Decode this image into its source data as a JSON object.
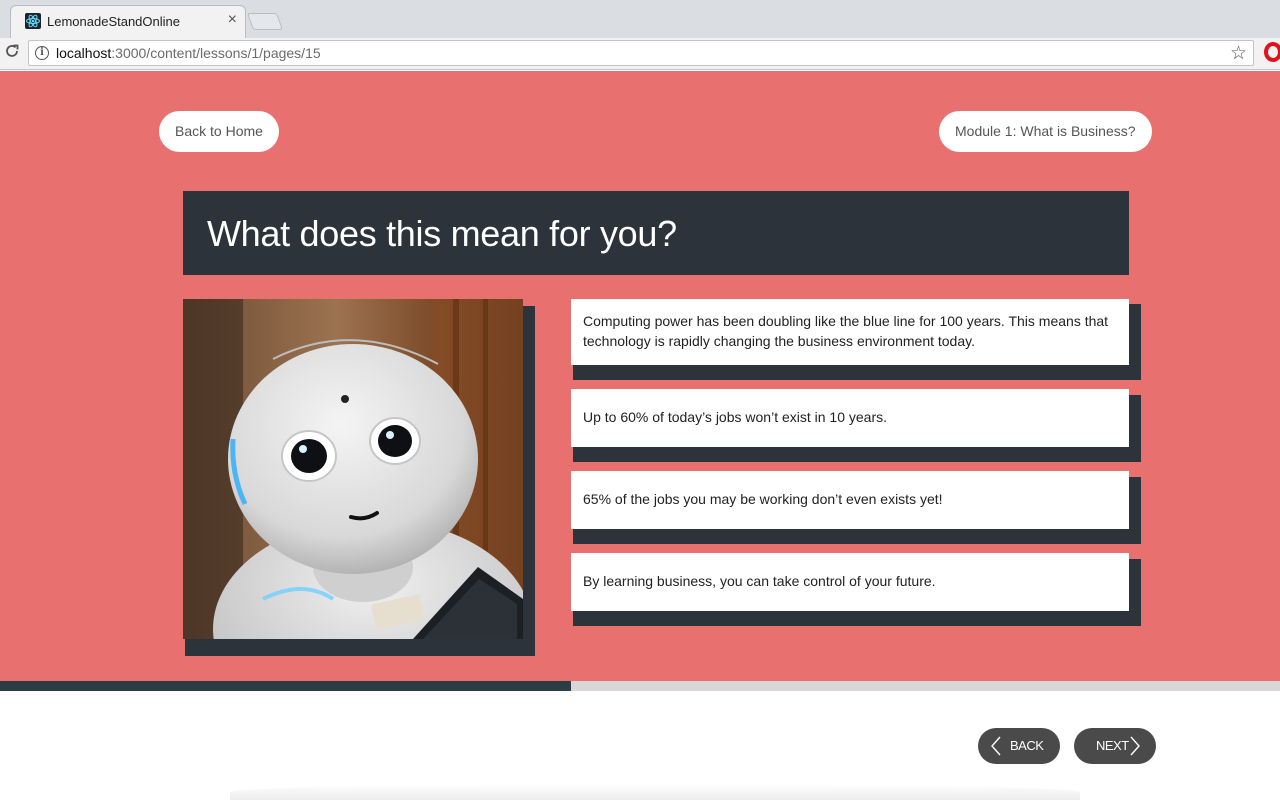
{
  "browser": {
    "tab_title": "LemonadeStandOnline",
    "tab_close": "×",
    "url_host": "localhost",
    "url_path": ":3000/content/lessons/1/pages/15"
  },
  "nav": {
    "back_home": "Back to Home",
    "module": "Module 1: What is Business?"
  },
  "lesson": {
    "title": "What does this mean for you?",
    "image_alt": "robot",
    "points": [
      "Computing power has been doubling like the blue line for 100 years. This means that technology is rapidly changing the business environment today.",
      "Up to 60% of today’s jobs won’t exist in 10 years.",
      "65% of the jobs you may be working don’t even exists yet!",
      "By learning business, you can take control of your future."
    ]
  },
  "progress": {
    "fraction": 0.446
  },
  "footer": {
    "back_label": "BACK",
    "next_label": "NEXT"
  },
  "colors": {
    "hero": "#e8716f",
    "dark": "#2c333b",
    "progress": "#2c3e45"
  },
  "icons": [
    "react-icon",
    "close-icon",
    "reload-icon",
    "info-icon",
    "star-icon",
    "opera-icon",
    "chevron-left-icon",
    "chevron-right-icon"
  ]
}
